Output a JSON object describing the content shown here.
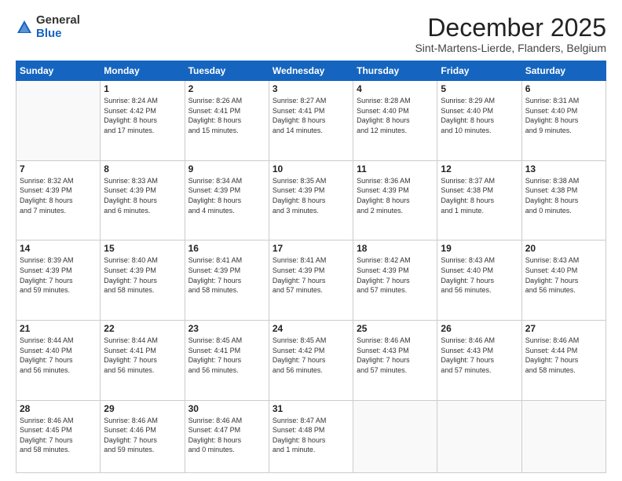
{
  "logo": {
    "general": "General",
    "blue": "Blue"
  },
  "title": "December 2025",
  "subtitle": "Sint-Martens-Lierde, Flanders, Belgium",
  "weekdays": [
    "Sunday",
    "Monday",
    "Tuesday",
    "Wednesday",
    "Thursday",
    "Friday",
    "Saturday"
  ],
  "weeks": [
    [
      {
        "day": null,
        "info": null
      },
      {
        "day": "1",
        "info": "Sunrise: 8:24 AM\nSunset: 4:42 PM\nDaylight: 8 hours\nand 17 minutes."
      },
      {
        "day": "2",
        "info": "Sunrise: 8:26 AM\nSunset: 4:41 PM\nDaylight: 8 hours\nand 15 minutes."
      },
      {
        "day": "3",
        "info": "Sunrise: 8:27 AM\nSunset: 4:41 PM\nDaylight: 8 hours\nand 14 minutes."
      },
      {
        "day": "4",
        "info": "Sunrise: 8:28 AM\nSunset: 4:40 PM\nDaylight: 8 hours\nand 12 minutes."
      },
      {
        "day": "5",
        "info": "Sunrise: 8:29 AM\nSunset: 4:40 PM\nDaylight: 8 hours\nand 10 minutes."
      },
      {
        "day": "6",
        "info": "Sunrise: 8:31 AM\nSunset: 4:40 PM\nDaylight: 8 hours\nand 9 minutes."
      }
    ],
    [
      {
        "day": "7",
        "info": "Sunrise: 8:32 AM\nSunset: 4:39 PM\nDaylight: 8 hours\nand 7 minutes."
      },
      {
        "day": "8",
        "info": "Sunrise: 8:33 AM\nSunset: 4:39 PM\nDaylight: 8 hours\nand 6 minutes."
      },
      {
        "day": "9",
        "info": "Sunrise: 8:34 AM\nSunset: 4:39 PM\nDaylight: 8 hours\nand 4 minutes."
      },
      {
        "day": "10",
        "info": "Sunrise: 8:35 AM\nSunset: 4:39 PM\nDaylight: 8 hours\nand 3 minutes."
      },
      {
        "day": "11",
        "info": "Sunrise: 8:36 AM\nSunset: 4:39 PM\nDaylight: 8 hours\nand 2 minutes."
      },
      {
        "day": "12",
        "info": "Sunrise: 8:37 AM\nSunset: 4:38 PM\nDaylight: 8 hours\nand 1 minute."
      },
      {
        "day": "13",
        "info": "Sunrise: 8:38 AM\nSunset: 4:38 PM\nDaylight: 8 hours\nand 0 minutes."
      }
    ],
    [
      {
        "day": "14",
        "info": "Sunrise: 8:39 AM\nSunset: 4:39 PM\nDaylight: 7 hours\nand 59 minutes."
      },
      {
        "day": "15",
        "info": "Sunrise: 8:40 AM\nSunset: 4:39 PM\nDaylight: 7 hours\nand 58 minutes."
      },
      {
        "day": "16",
        "info": "Sunrise: 8:41 AM\nSunset: 4:39 PM\nDaylight: 7 hours\nand 58 minutes."
      },
      {
        "day": "17",
        "info": "Sunrise: 8:41 AM\nSunset: 4:39 PM\nDaylight: 7 hours\nand 57 minutes."
      },
      {
        "day": "18",
        "info": "Sunrise: 8:42 AM\nSunset: 4:39 PM\nDaylight: 7 hours\nand 57 minutes."
      },
      {
        "day": "19",
        "info": "Sunrise: 8:43 AM\nSunset: 4:40 PM\nDaylight: 7 hours\nand 56 minutes."
      },
      {
        "day": "20",
        "info": "Sunrise: 8:43 AM\nSunset: 4:40 PM\nDaylight: 7 hours\nand 56 minutes."
      }
    ],
    [
      {
        "day": "21",
        "info": "Sunrise: 8:44 AM\nSunset: 4:40 PM\nDaylight: 7 hours\nand 56 minutes."
      },
      {
        "day": "22",
        "info": "Sunrise: 8:44 AM\nSunset: 4:41 PM\nDaylight: 7 hours\nand 56 minutes."
      },
      {
        "day": "23",
        "info": "Sunrise: 8:45 AM\nSunset: 4:41 PM\nDaylight: 7 hours\nand 56 minutes."
      },
      {
        "day": "24",
        "info": "Sunrise: 8:45 AM\nSunset: 4:42 PM\nDaylight: 7 hours\nand 56 minutes."
      },
      {
        "day": "25",
        "info": "Sunrise: 8:46 AM\nSunset: 4:43 PM\nDaylight: 7 hours\nand 57 minutes."
      },
      {
        "day": "26",
        "info": "Sunrise: 8:46 AM\nSunset: 4:43 PM\nDaylight: 7 hours\nand 57 minutes."
      },
      {
        "day": "27",
        "info": "Sunrise: 8:46 AM\nSunset: 4:44 PM\nDaylight: 7 hours\nand 58 minutes."
      }
    ],
    [
      {
        "day": "28",
        "info": "Sunrise: 8:46 AM\nSunset: 4:45 PM\nDaylight: 7 hours\nand 58 minutes."
      },
      {
        "day": "29",
        "info": "Sunrise: 8:46 AM\nSunset: 4:46 PM\nDaylight: 7 hours\nand 59 minutes."
      },
      {
        "day": "30",
        "info": "Sunrise: 8:46 AM\nSunset: 4:47 PM\nDaylight: 8 hours\nand 0 minutes."
      },
      {
        "day": "31",
        "info": "Sunrise: 8:47 AM\nSunset: 4:48 PM\nDaylight: 8 hours\nand 1 minute."
      },
      {
        "day": null,
        "info": null
      },
      {
        "day": null,
        "info": null
      },
      {
        "day": null,
        "info": null
      }
    ]
  ]
}
